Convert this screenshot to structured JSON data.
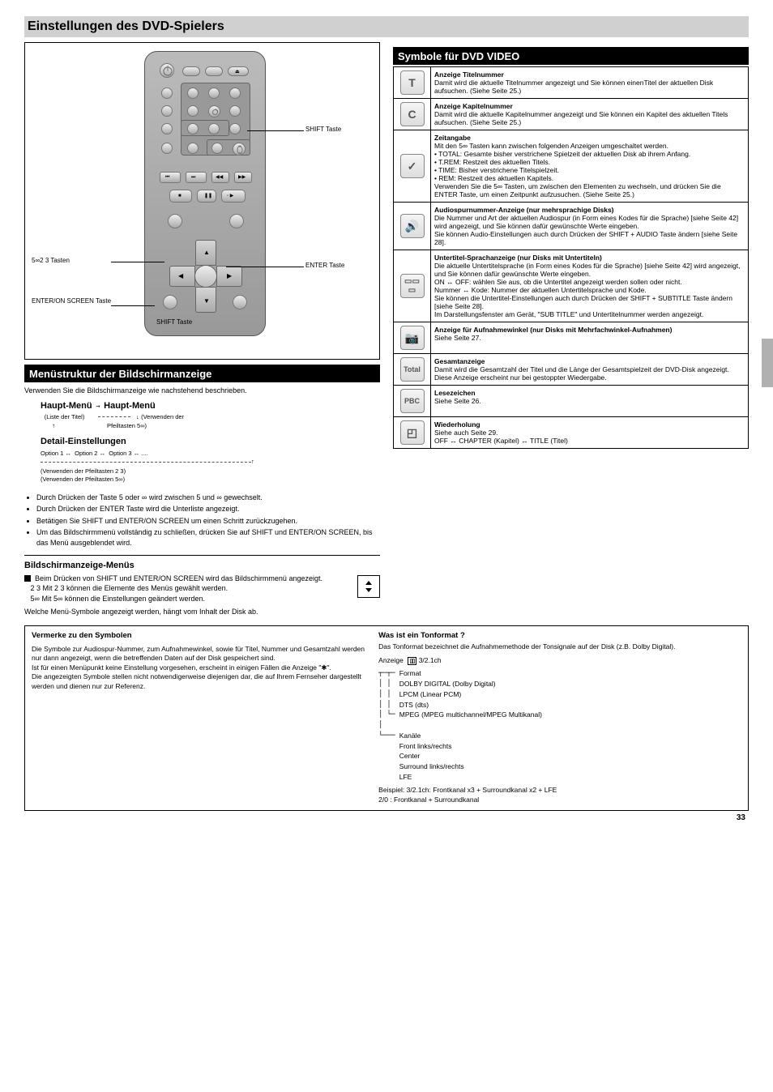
{
  "pageTitle": "Einstellungen des DVD-Spielers",
  "pageNumber": "33",
  "remoteBox": {
    "btnUpDownLeftRight": "5∞2 3 Tasten",
    "btnEnterOnScreen": "ENTER/ON SCREEN Taste",
    "btnShiftLeft": "SHIFT Taste",
    "btnShiftRight": "SHIFT Taste",
    "btnEnter": "ENTER Taste"
  },
  "leftStrip": "Menüstruktur der Bildschirmanzeige",
  "leftLeadIn": "Verwenden Sie die Bildschirmanzeige wie nachstehend beschrieben.",
  "hierarchy": {
    "h1": "Haupt-Menü",
    "h1sub": "(Liste der Titel)",
    "h2": "Haupt-Menü",
    "h2sub": "(Verwenden der",
    "h2sub2": "Pfeiltasten 5∞)",
    "h3": "Detail-Einstellungen",
    "h4": "Option 1",
    "h5": "Option 2",
    "h6": "Option 3",
    "h4sub": "(Verwenden der Pfeiltasten 2 3)",
    "h5sub": "(Verwenden der Pfeiltasten 5∞)"
  },
  "bullets": [
    "Durch Drücken der Taste 5 oder ∞ wird zwischen 5 und ∞ gewechselt.",
    "Durch Drücken der ENTER Taste wird die Unterliste angezeigt.",
    "Betätigen Sie SHIFT und ENTER/ON SCREEN um einen Schritt zurückzugehen.",
    "Um das Bildschirmmenü vollständig zu schließen, drücken Sie auf SHIFT und ENTER/ON SCREEN, bis das Menü ausgeblendet wird."
  ],
  "midHeading": "Bildschirmanzeige-Menüs",
  "midBlock": {
    "lead": "Beim Drücken von SHIFT und ENTER/ON SCREEN wird das Bildschirmmenü angezeigt.",
    "lead2": "Mit 2 3 können die Elemente des Menüs gewählt werden.",
    "lead3": "Mit 5∞ können die Einstellungen geändert werden.",
    "postNote": "Welche Menü-Symbole angezeigt werden, hängt vom Inhalt der Disk ab."
  },
  "rightStrip": "Symbole für DVD VIDEO",
  "table": [
    {
      "icon": "T",
      "hd": "Anzeige Titelnummer",
      "body": "Damit wird die aktuelle Titelnummer angezeigt und Sie können einenTitel der aktuellen Disk aufsuchen. (Siehe Seite 25.)"
    },
    {
      "icon": "C",
      "hd": "Anzeige Kapitelnummer",
      "body": "Damit wird die aktuelle Kapitelnummer angezeigt und Sie können ein Kapitel des aktuellen Titels aufsuchen. (Siehe Seite 25.)"
    },
    {
      "icon": "⏱",
      "hd": "Zeitangabe",
      "body": "Mit den 5∞ Tasten kann zwischen folgenden Anzeigen umgeschaltet werden.\n• TOTAL: Gesamte bisher verstrichene Spielzeit der aktuellen Disk ab ihrem Anfang.\n• T.REM: Restzeit des aktuellen Titels.\n• TIME: Bisher verstrichene Titelspielzeit.\n• REM: Restzeit des aktuellen Kapitels.\nVerwenden Sie die 5∞ Tasten, um zwischen den Elementen zu wechseln, und drücken Sie die ENTER Taste, um einen Zeitpunkt aufzusuchen. (Siehe Seite 25.)"
    },
    {
      "icon": "🔊",
      "hd": "Audiospurnummer-Anzeige (nur mehrsprachige Disks)",
      "body": "Die Nummer und Art der aktuellen Audiospur (in Form eines Kodes für die Sprache) [siehe Seite 42] wird angezeigt, und Sie können dafür gewünschte Werte eingeben.\nSie können Audio-Einstellungen auch durch Drücken der SHIFT + AUDIO Taste ändern [siehe Seite 28]."
    },
    {
      "icon": "▭▭",
      "hd": "Untertitel-Sprachanzeige (nur Disks mit Untertiteln)",
      "body": "Die aktuelle Untertitelsprache (in Form eines Kodes für die Sprache) [siehe Seite 42] wird angezeigt, und Sie können dafür gewünschte Werte eingeben.\nON ↔ OFF: wählen Sie aus, ob die Untertitel angezeigt werden sollen oder nicht.\nNummer ↔ Kode: Nummer der aktuellen Untertitelsprache und Kode.\nSie können die Untertitel-Einstellungen auch durch Drücken der SHIFT + SUBTITLE Taste ändern [siehe Seite 28].\nIm Darstellungsfenster am Gerät, \"SUB TITLE\" und Untertitelnummer werden angezeigt."
    },
    {
      "icon": "📷",
      "hd": "Anzeige für Aufnahmewinkel (nur Disks mit Mehrfachwinkel-Aufnahmen)",
      "body": "Siehe Seite 27."
    },
    {
      "icon": "Total",
      "hd": "Gesamtanzeige",
      "body": "Damit wird die Gesamtzahl der Titel und die Länge der Gesamtspielzeit der DVD-Disk angezeigt. Diese Anzeige erscheint nur bei gestoppter Wiedergabe."
    },
    {
      "icon": "PBC",
      "hd": "Lesezeichen",
      "body": "Siehe Seite 26."
    },
    {
      "icon": "▢",
      "hd": "Wiederholung",
      "body": "Siehe auch Seite 29.\nOFF ↔ CHAPTER (Kapitel) ↔ TITLE (Titel)"
    }
  ],
  "bottomLeft": {
    "title": "Vermerke zu den Symbolen",
    "body": "Die Symbole zur Audiospur-Nummer, zum Aufnahmewinkel, sowie für Titel, Nummer und Gesamtzahl werden nur dann angezeigt, wenn die betreffenden Daten auf der Disk gespeichert sind.\nIst für einen Menüpunkt keine Einstellung vorgesehen, erscheint in einigen Fällen die Anzeige \"✱\".\nDie angezeigten Symbole stellen nicht notwendigerweise diejenigen dar, die auf Ihrem Fernseher dargestellt werden und dienen nur zur Referenz."
  },
  "bottomRight": {
    "title": "Was ist ein Tonformat ?",
    "desc1": "Das Tonformat bezeichnet die Aufnahmemethode der Tonsignale auf der Disk (z.B. Dolby Digital).",
    "dispLabel": "Anzeige",
    "dolbyIcon": "▯▯",
    "tree": {
      "r1_fmt": "Format",
      "r1_dig": "DOLBY DIGITAL (Dolby Digital)",
      "r2_lpcm": "LPCM (Linear PCM)",
      "r2_dts": "DTS (dts)",
      "r2_mpeg": "MPEG (MPEG multichannel/MPEG Multikanal)",
      "kanale": "Kanäle",
      "front": "Front links/rechts",
      "center": "Center",
      "surround": "Surround links/rechts",
      "lfe": "LFE",
      "ex3": "Beispiel: 3/2.1ch: Frontkanal x3 + Surroundkanal x2 + LFE",
      "ex2": "2/0 : Frontkanal + Surroundkanal"
    }
  }
}
